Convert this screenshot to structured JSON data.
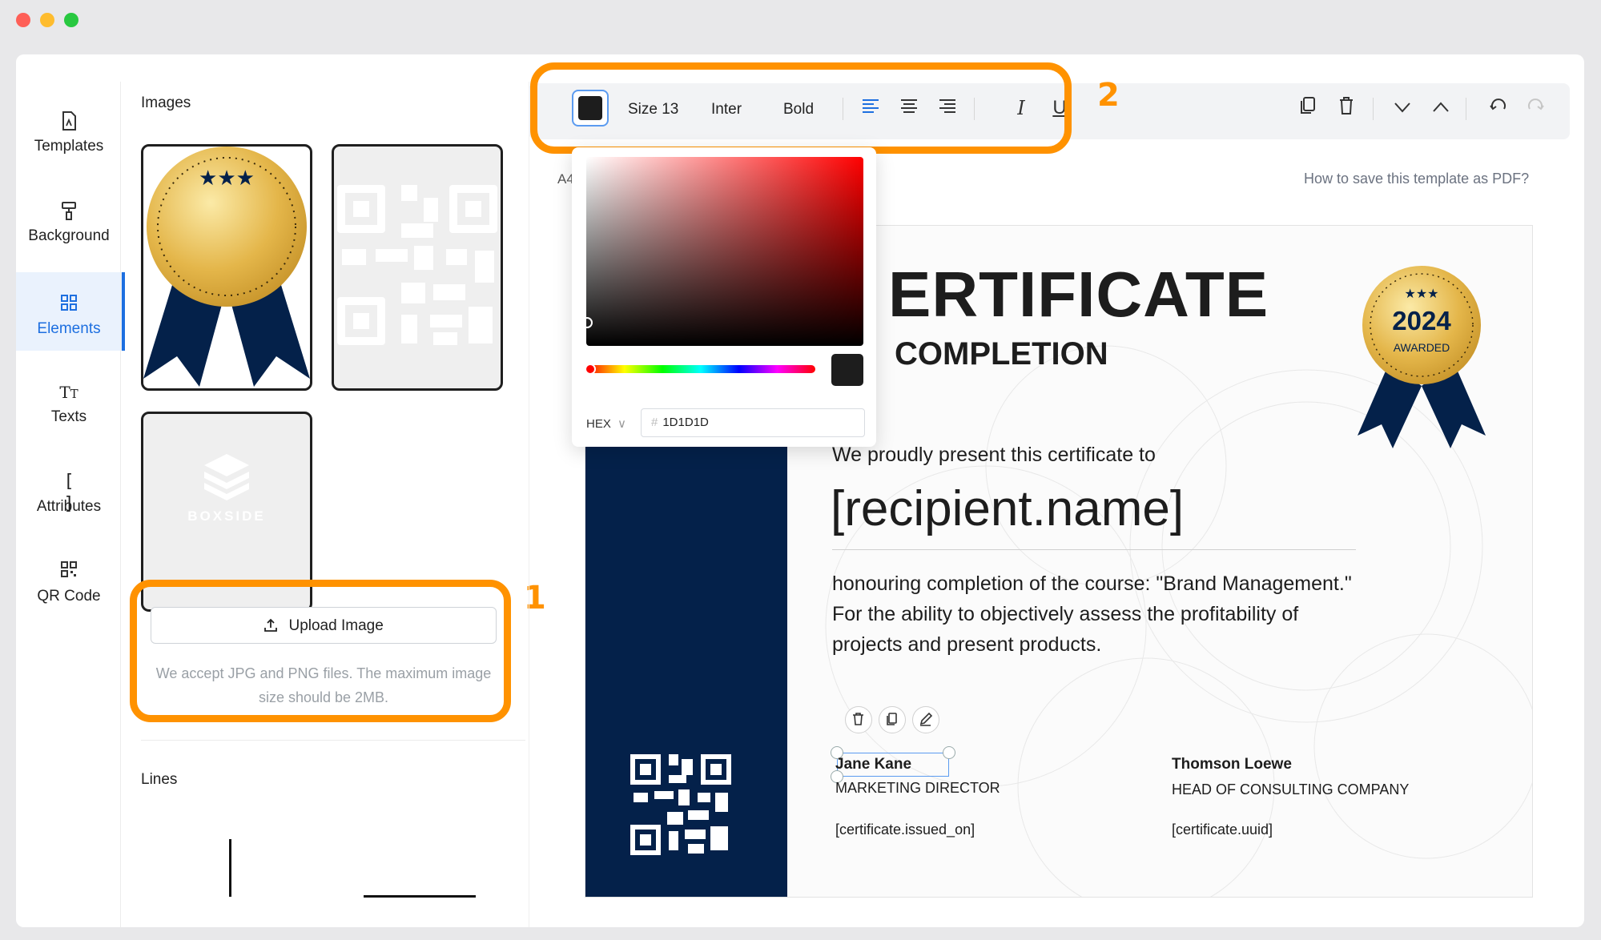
{
  "nav": {
    "items": [
      {
        "label": "Templates",
        "icon": "template-icon"
      },
      {
        "label": "Background",
        "icon": "paint-roller-icon"
      },
      {
        "label": "Elements",
        "icon": "elements-grid-icon",
        "active": true
      },
      {
        "label": "Texts",
        "icon": "text-icon"
      },
      {
        "label": "Attributes",
        "icon": "brackets-icon"
      },
      {
        "label": "QR Code",
        "icon": "qr-code-icon"
      }
    ]
  },
  "images_panel": {
    "title": "Images",
    "logo_text": "BOXSIDE",
    "upload_label": "Upload Image",
    "upload_note": "We accept JPG and PNG files. The maximum image size should be 2MB.",
    "lines_title": "Lines",
    "callout_number": "1"
  },
  "toolbar": {
    "color": "#1D1D1D",
    "size_label": "Size 13",
    "font_label": "Inter",
    "weight_label": "Bold",
    "callout_number": "2"
  },
  "color_picker": {
    "mode_label": "HEX",
    "hash": "#",
    "hex_value": "1D1D1D"
  },
  "canvas": {
    "page_size_label": "A4",
    "help_link": "How to save this template as PDF?"
  },
  "certificate": {
    "title": "ERTIFICATE",
    "subtitle": "COMPLETION",
    "badge_year": "2024",
    "badge_label": "AWARDED",
    "present_line": "We proudly present this certificate to",
    "recipient": "[recipient.name]",
    "body_lines": [
      "honouring completion of the course: \"Brand Management.\"",
      "For the ability to objectively assess the profitability of",
      "projects and present products."
    ],
    "signer1_name": "Jane Kane",
    "signer1_role": "MARKETING DIRECTOR",
    "issued_on": "[certificate.issued_on]",
    "signer2_name": "Thomson Loewe",
    "signer2_role": "HEAD OF CONSULTING COMPANY",
    "uuid": "[certificate.uuid]"
  },
  "colors": {
    "accent": "#1D6FE0",
    "highlight": "#FF9200",
    "navy": "#04214A",
    "gold": "#E2B33C"
  }
}
